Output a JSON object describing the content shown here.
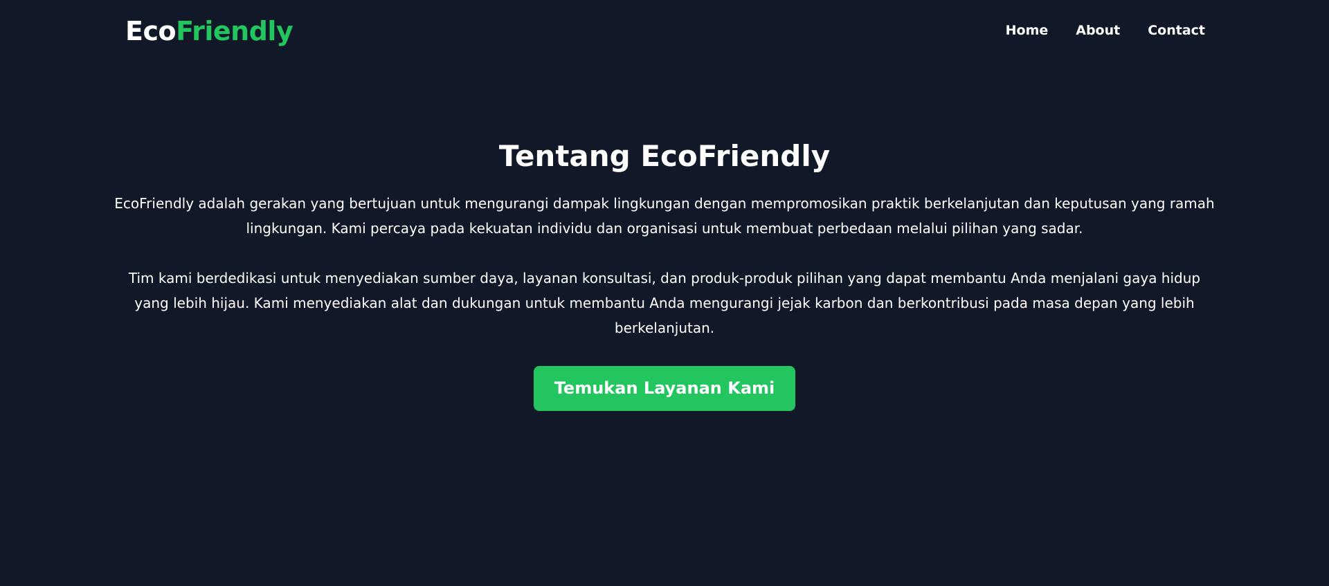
{
  "header": {
    "logo_part1": "Eco",
    "logo_part2": "Friendly",
    "nav": {
      "home": "Home",
      "about": "About",
      "contact": "Contact"
    }
  },
  "hero": {
    "title": "Tentang EcoFriendly",
    "paragraph1": "EcoFriendly adalah gerakan yang bertujuan untuk mengurangi dampak lingkungan dengan mempromosikan praktik berkelanjutan dan keputusan yang ramah lingkungan. Kami percaya pada kekuatan individu dan organisasi untuk membuat perbedaan melalui pilihan yang sadar.",
    "paragraph2": "Tim kami berdedikasi untuk menyediakan sumber daya, layanan konsultasi, dan produk-produk pilihan yang dapat membantu Anda menjalani gaya hidup yang lebih hijau. Kami menyediakan alat dan dukungan untuk membantu Anda mengurangi jejak karbon dan berkontribusi pada masa depan yang lebih berkelanjutan.",
    "cta_label": "Temukan Layanan Kami"
  },
  "colors": {
    "background": "#111827",
    "accent": "#22c55e",
    "text": "#ffffff"
  }
}
